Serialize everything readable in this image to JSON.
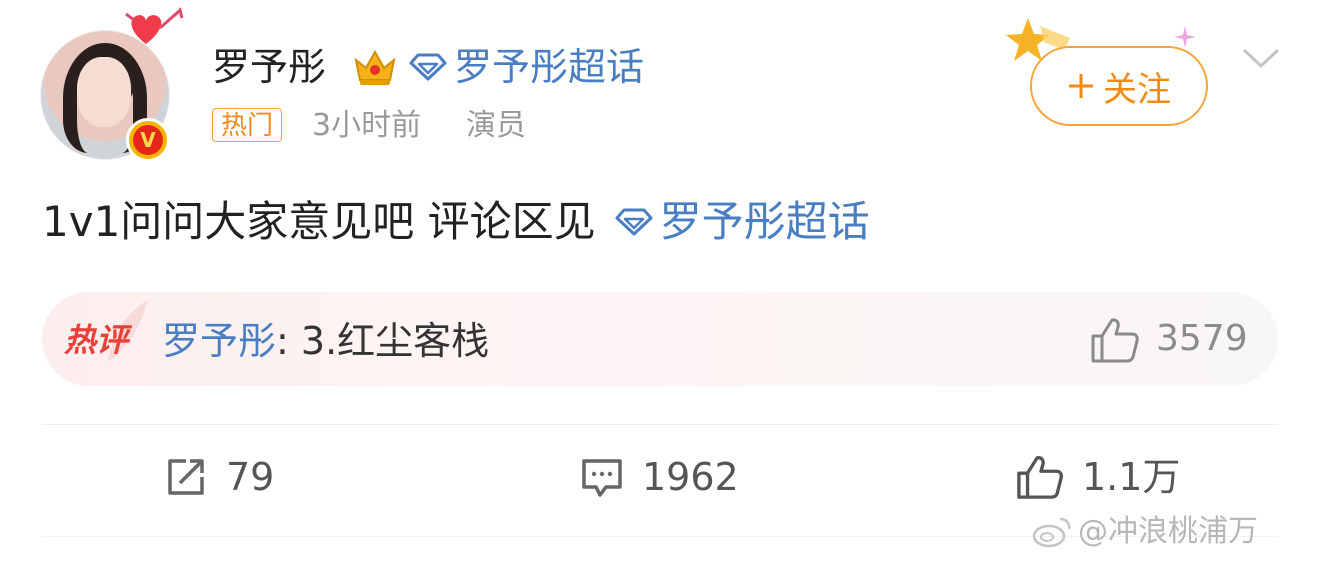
{
  "user": {
    "name": "罗予彤"
  },
  "header_topic": {
    "label": "罗予彤超话"
  },
  "meta": {
    "badge": "热门",
    "time": "3小时前",
    "role": "演员"
  },
  "follow": {
    "label": "关注"
  },
  "post": {
    "text": "1v1问问大家意见吧 评论区见",
    "topic_label": "罗予彤超话"
  },
  "hot_comment": {
    "label": "热评",
    "user": "罗予彤",
    "separator": ": ",
    "text": "3.红尘客栈",
    "likes": "3579"
  },
  "actions": {
    "reposts": "79",
    "comments": "1962",
    "likes": "1.1万"
  },
  "watermark": {
    "text": "@冲浪桃浦万"
  },
  "colors": {
    "link": "#4a7ec2",
    "follow": "#f08a14",
    "hot_label": "#e8413a",
    "badge": "#ee8a1f"
  },
  "icons": [
    "heart-arrow-icon",
    "verified-v-icon",
    "crown-icon",
    "diamond-icon",
    "star-icon",
    "sparkle-icon",
    "chevron-down-icon",
    "plus-icon",
    "feather-icon",
    "thumb-up-icon",
    "repost-icon",
    "comment-icon",
    "weibo-logo-icon"
  ]
}
